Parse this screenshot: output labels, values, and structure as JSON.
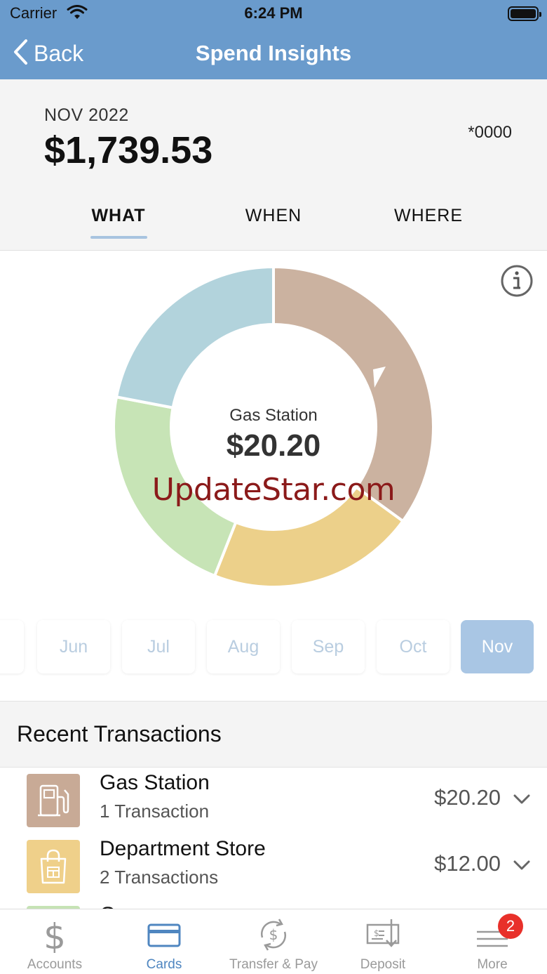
{
  "status_bar": {
    "carrier": "Carrier",
    "time": "6:24 PM"
  },
  "nav": {
    "back_label": "Back",
    "title": "Spend Insights"
  },
  "summary": {
    "period": "NOV 2022",
    "total": "$1,739.53",
    "account_mask": "*0000"
  },
  "tabs": [
    {
      "label": "WHAT",
      "active": true
    },
    {
      "label": "WHEN",
      "active": false
    },
    {
      "label": "WHERE",
      "active": false
    }
  ],
  "chart_data": {
    "type": "pie",
    "style": "donut",
    "selected_category": "Gas Station",
    "selected_value": "$20.20",
    "slices": [
      {
        "color": "#cbb2a0",
        "value": 0.35
      },
      {
        "color": "#ecd08a",
        "value": 0.21
      },
      {
        "color": "#c7e4b6",
        "value": 0.22
      },
      {
        "color": "#b2d3dc",
        "value": 0.22
      }
    ]
  },
  "watermark": "UpdateStar.com",
  "months": [
    {
      "label": "y",
      "active": false
    },
    {
      "label": "Jun",
      "active": false
    },
    {
      "label": "Jul",
      "active": false
    },
    {
      "label": "Aug",
      "active": false
    },
    {
      "label": "Sep",
      "active": false
    },
    {
      "label": "Oct",
      "active": false
    },
    {
      "label": "Nov",
      "active": true
    }
  ],
  "recent": {
    "title": "Recent Transactions",
    "items": [
      {
        "name": "Gas Station",
        "count": "1 Transaction",
        "amount": "$20.20",
        "icon": "gas-pump-icon",
        "color": "#c8aa96"
      },
      {
        "name": "Department Store",
        "count": "2 Transactions",
        "amount": "$12.00",
        "icon": "shopping-bag-icon",
        "color": "#efd08a"
      },
      {
        "name": "G",
        "count": "",
        "amount": "",
        "icon": "grocery-icon",
        "color": "#c6e3b5"
      }
    ]
  },
  "tabbar": [
    {
      "label": "Accounts",
      "icon": "dollar-icon",
      "active": false
    },
    {
      "label": "Cards",
      "icon": "card-icon",
      "active": true
    },
    {
      "label": "Transfer & Pay",
      "icon": "transfer-icon",
      "active": false
    },
    {
      "label": "Deposit",
      "icon": "check-deposit-icon",
      "active": false
    },
    {
      "label": "More",
      "icon": "menu-icon",
      "active": false,
      "badge": "2"
    }
  ],
  "colors": {
    "nav_bg": "#6a9bcc",
    "accent": "#4f86c0",
    "month_active": "#a9c6e4",
    "badge": "#e8302a"
  }
}
